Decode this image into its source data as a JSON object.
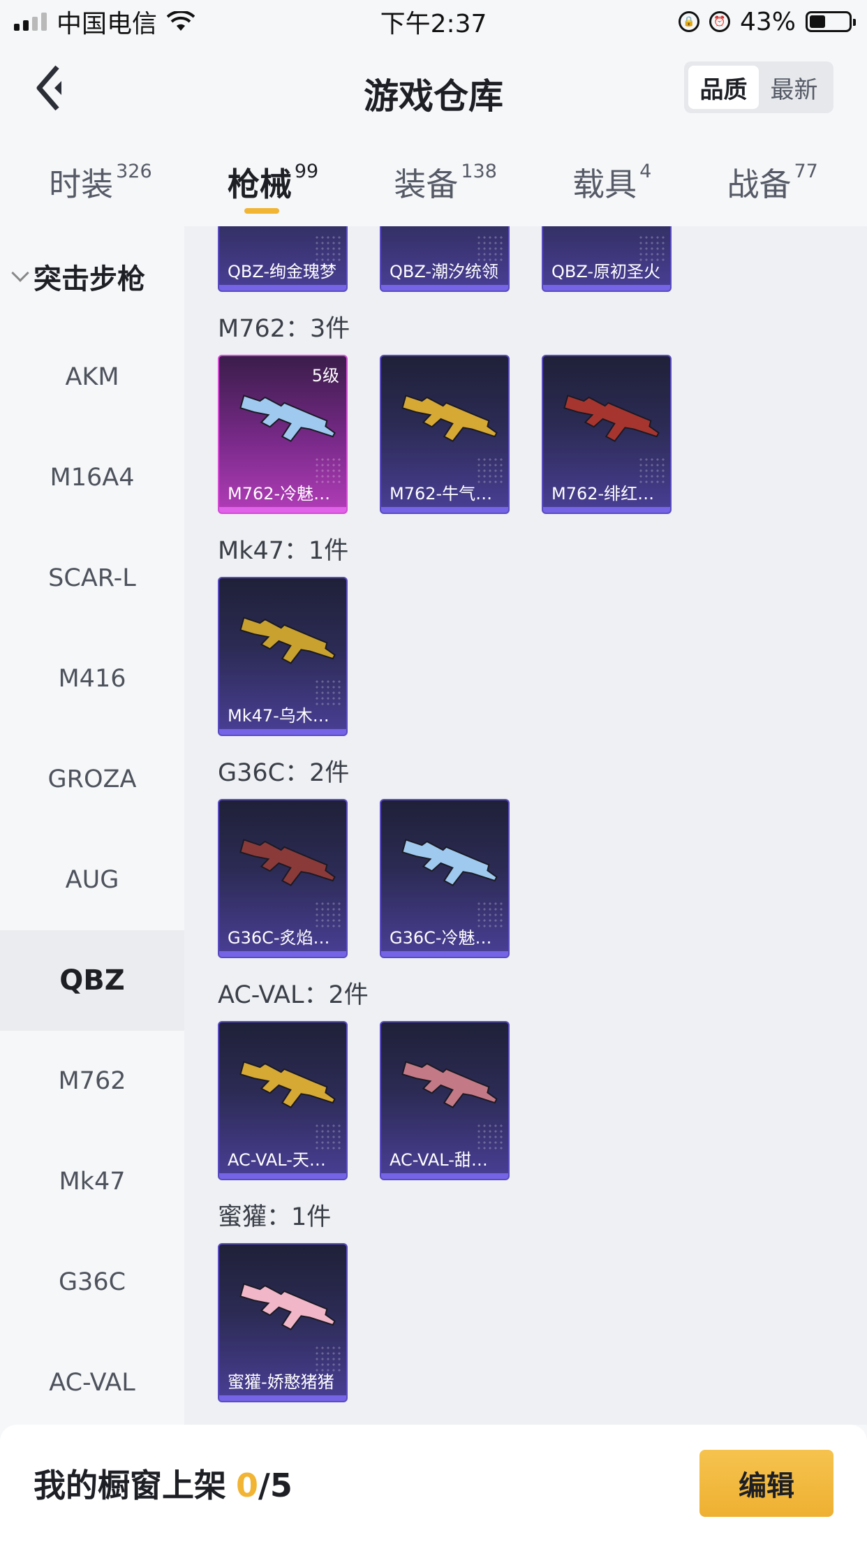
{
  "status_bar": {
    "carrier": "中国电信",
    "time": "下午2:37",
    "battery": "43%"
  },
  "header": {
    "title": "游戏仓库",
    "sort_options": [
      {
        "label": "品质",
        "active": true
      },
      {
        "label": "最新",
        "active": false
      }
    ]
  },
  "tabs": [
    {
      "label": "时装",
      "count": "326"
    },
    {
      "label": "枪械",
      "count": "99"
    },
    {
      "label": "装备",
      "count": "138"
    },
    {
      "label": "载具",
      "count": "4"
    },
    {
      "label": "战备",
      "count": "77"
    }
  ],
  "active_tab": "枪械",
  "sidebar": {
    "group": "突击步枪",
    "items": [
      "AKM",
      "M16A4",
      "SCAR-L",
      "M416",
      "GROZA",
      "AUG",
      "QBZ",
      "M762",
      "Mk47",
      "G36C",
      "AC-VAL"
    ],
    "active_item": "QBZ"
  },
  "content": {
    "top_cards": [
      "QBZ-绚金瑰梦",
      "QBZ-潮汐统领",
      "QBZ-原初圣火"
    ],
    "groups": [
      {
        "title": "M762：3件",
        "cards": [
          {
            "name": "M762-冷魅…",
            "level": "5级",
            "quality": "purple",
            "gun_color": "#9fc9ef"
          },
          {
            "name": "M762-牛气…",
            "level": "",
            "quality": "blue",
            "gun_color": "#d6a834"
          },
          {
            "name": "M762-绯红…",
            "level": "",
            "quality": "blue",
            "gun_color": "#a7352f"
          }
        ]
      },
      {
        "title": "Mk47：1件",
        "cards": [
          {
            "name": "Mk47-乌木…",
            "level": "",
            "quality": "blue",
            "gun_color": "#c9a12e"
          }
        ]
      },
      {
        "title": "G36C：2件",
        "cards": [
          {
            "name": "G36C-炙焰…",
            "level": "",
            "quality": "blue",
            "gun_color": "#8b3a3a"
          },
          {
            "name": "G36C-冷魅…",
            "level": "",
            "quality": "blue",
            "gun_color": "#9fc9ef"
          }
        ]
      },
      {
        "title": "AC-VAL：2件",
        "cards": [
          {
            "name": "AC-VAL-天…",
            "level": "",
            "quality": "blue",
            "gun_color": "#d6a834"
          },
          {
            "name": "AC-VAL-甜…",
            "level": "",
            "quality": "blue",
            "gun_color": "#c47a86"
          }
        ]
      },
      {
        "title": "蜜獾：1件",
        "cards": [
          {
            "name": "蜜獾-娇憨猪猪",
            "level": "",
            "quality": "blue",
            "gun_color": "#f1b6c8"
          }
        ]
      }
    ]
  },
  "footer": {
    "showcase_label": "我的橱窗上架",
    "showcase_count": "0",
    "showcase_total": "/5",
    "edit_label": "编辑"
  },
  "colors": {
    "accent": "#f1b433",
    "card_blue_border": "#5a4cc0",
    "card_purple_border": "#d24cd4"
  }
}
